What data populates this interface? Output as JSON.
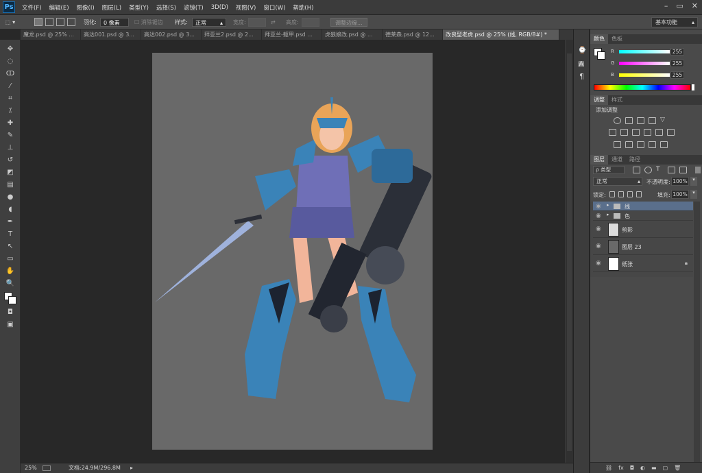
{
  "app": {
    "logo": "Ps",
    "menus": [
      "文件(F)",
      "编辑(E)",
      "图像(I)",
      "图层(L)",
      "类型(Y)",
      "选择(S)",
      "滤镜(T)",
      "3D(D)",
      "视图(V)",
      "窗口(W)",
      "帮助(H)"
    ]
  },
  "options": {
    "feather_label": "羽化:",
    "feather_value": "0 像素",
    "antialias_label": "消除锯齿",
    "style_label": "样式:",
    "style_value": "正常",
    "width_label": "宽度:",
    "height_label": "高度:",
    "refine_edge": "调整边缘...",
    "workspace": "基本功能"
  },
  "tabs": [
    "魔龙.psd @ 25% ...",
    "高达001.psd @ 3...",
    "高达002.psd @ 3...",
    "拜亚兰2.psd @ 2...",
    "拜亚兰-躯甲.psd ...",
    "虎狼娘改.psd @ ...",
    "德莱森.psd @ 12...",
    "改良型老虎.psd @ 25% (线, RGB/8#) *"
  ],
  "status": {
    "zoom": "25%",
    "doc": "文档:24.9M/296.8M"
  },
  "color_panel": {
    "tabs": [
      "颜色",
      "色板"
    ],
    "r_label": "R",
    "g_label": "G",
    "b_label": "B",
    "r": "255",
    "g": "255",
    "b": "255"
  },
  "adjust_panel": {
    "tabs": [
      "调整",
      "样式"
    ],
    "title": "添加调整"
  },
  "layers_panel": {
    "tabs": [
      "图层",
      "通道",
      "路径"
    ],
    "kind": "ρ 类型",
    "blend_mode": "正常",
    "opacity_label": "不透明度:",
    "opacity": "100%",
    "lock_label": "锁定:",
    "fill_label": "填充:",
    "fill": "100%",
    "layers": [
      {
        "name": "线",
        "type": "group"
      },
      {
        "name": "色",
        "type": "group"
      },
      {
        "name": "剪影",
        "type": "layer"
      },
      {
        "name": "图层 23",
        "type": "layer"
      },
      {
        "name": "纸张",
        "type": "background"
      }
    ]
  },
  "colors": {
    "accent": "#1b6fb1",
    "selected_layer": "#5a6f8c",
    "canvas": "#696969"
  }
}
